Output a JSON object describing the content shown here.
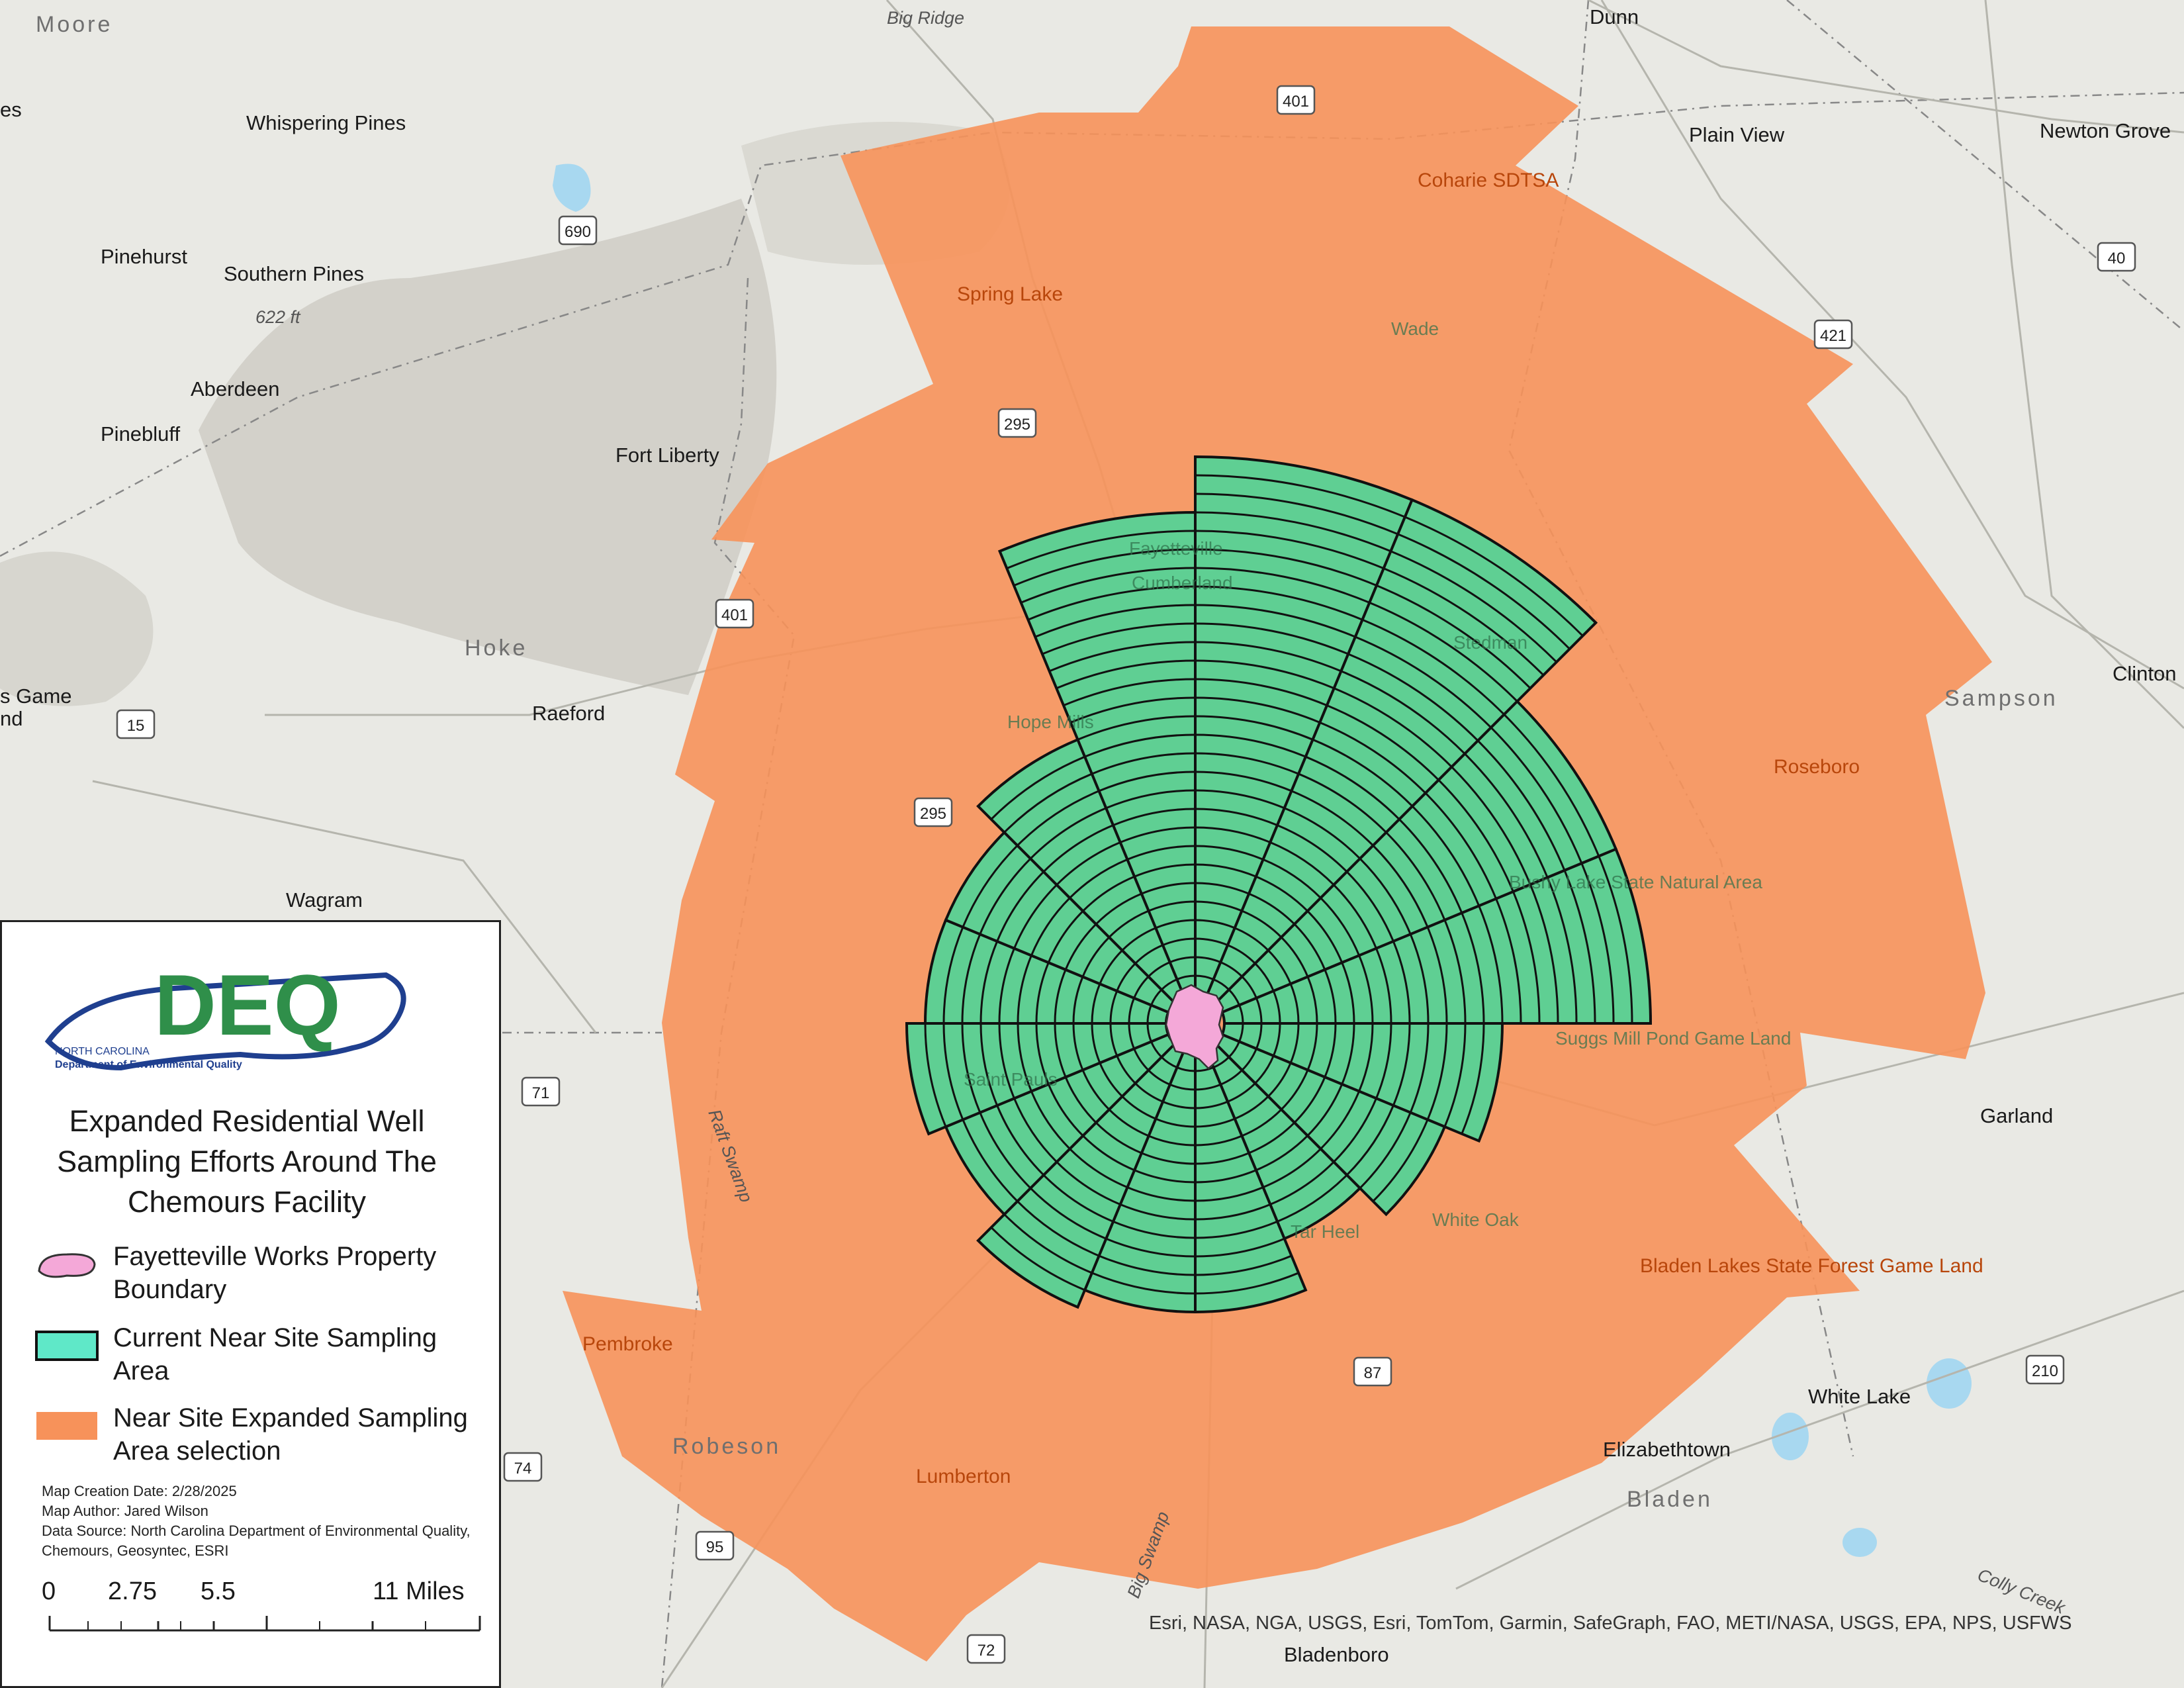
{
  "map": {
    "places": [
      {
        "name": "Moore",
        "kind": "region"
      },
      {
        "name": "Big Ridge",
        "kind": "feature"
      },
      {
        "name": "Dunn",
        "kind": "place"
      },
      {
        "name": "Whispering Pines",
        "kind": "place"
      },
      {
        "name": "Plain View",
        "kind": "place"
      },
      {
        "name": "Newton Grove",
        "kind": "place"
      },
      {
        "name": "Coharie SDTSA",
        "kind": "orange"
      },
      {
        "name": "Pinehurst",
        "kind": "place"
      },
      {
        "name": "Southern Pines",
        "kind": "place"
      },
      {
        "name": "622 ft",
        "kind": "feature"
      },
      {
        "name": "Spring Lake",
        "kind": "orange"
      },
      {
        "name": "Aberdeen",
        "kind": "place"
      },
      {
        "name": "Wade",
        "kind": "light"
      },
      {
        "name": "Pinebluff",
        "kind": "place"
      },
      {
        "name": "Fort Liberty",
        "kind": "place"
      },
      {
        "name": "Fayetteville",
        "kind": "light"
      },
      {
        "name": "Cumberland",
        "kind": "light"
      },
      {
        "name": "Hoke",
        "kind": "region"
      },
      {
        "name": "Stedman",
        "kind": "light"
      },
      {
        "name": "Sampson",
        "kind": "region"
      },
      {
        "name": "Clinton",
        "kind": "place"
      },
      {
        "name": "Raeford",
        "kind": "place"
      },
      {
        "name": "Hope Mills",
        "kind": "light"
      },
      {
        "name": "Roseboro",
        "kind": "orange"
      },
      {
        "name": "Wagram",
        "kind": "place"
      },
      {
        "name": "Bushy Lake State Natural Area",
        "kind": "light"
      },
      {
        "name": "Suggs Mill Pond Game Land",
        "kind": "light"
      },
      {
        "name": "Saint Pauls",
        "kind": "light"
      },
      {
        "name": "Garland",
        "kind": "place"
      },
      {
        "name": "Raft Swamp",
        "kind": "feature"
      },
      {
        "name": "Tar Heel",
        "kind": "light"
      },
      {
        "name": "White Oak",
        "kind": "light"
      },
      {
        "name": "Bladen Lakes State Forest Game Land",
        "kind": "orange"
      },
      {
        "name": "Pembroke",
        "kind": "orange"
      },
      {
        "name": "White Lake",
        "kind": "place"
      },
      {
        "name": "Robeson",
        "kind": "region"
      },
      {
        "name": "Elizabethtown",
        "kind": "place"
      },
      {
        "name": "Lumberton",
        "kind": "orange"
      },
      {
        "name": "Bladen",
        "kind": "region"
      },
      {
        "name": "Colly Creek",
        "kind": "feature"
      },
      {
        "name": "Big Swamp",
        "kind": "feature"
      },
      {
        "name": "Bladenboro",
        "kind": "place"
      },
      {
        "name": "es",
        "kind": "place"
      },
      {
        "name": "s Game",
        "kind": "place"
      },
      {
        "name": "nd",
        "kind": "place"
      }
    ],
    "routes": [
      "401",
      "690",
      "40",
      "421",
      "295",
      "401",
      "15",
      "295",
      "71",
      "87",
      "74",
      "95",
      "210",
      "72"
    ],
    "attribution": "Esri, NASA, NGA, USGS, Esri, TomTom, Garmin, SafeGraph, FAO, METI/NASA, USGS, EPA, NPS, USFWS",
    "colors": {
      "expanded_area": "#f7925a",
      "current_area": "#5fcf93",
      "property": "#f4a8d8",
      "land": "#e9e9e4",
      "hills": "#cfcdc6"
    }
  },
  "legend": {
    "logo_text": "DEQ",
    "logo_subtitle_1": "NORTH CAROLINA",
    "logo_subtitle_2": "Department of Environmental Quality",
    "title": "Expanded Residential Well Sampling Efforts Around The Chemours Facility",
    "items": [
      {
        "label": "Fayetteville Works Property Boundary",
        "swatch": "property"
      },
      {
        "label": "Current Near Site Sampling Area",
        "swatch": "current"
      },
      {
        "label": "Near Site Expanded Sampling Area  selection",
        "swatch": "expanded"
      }
    ],
    "creation_date": "Map Creation Date: 2/28/2025",
    "author": "Map Author: Jared Wilson",
    "data_source": "Data Source: North Carolina Department of Environmental Quality, Chemours, Geosyntec, ESRI",
    "scale": {
      "labels": [
        "0",
        "2.75",
        "5.5",
        "11 Miles"
      ]
    }
  }
}
